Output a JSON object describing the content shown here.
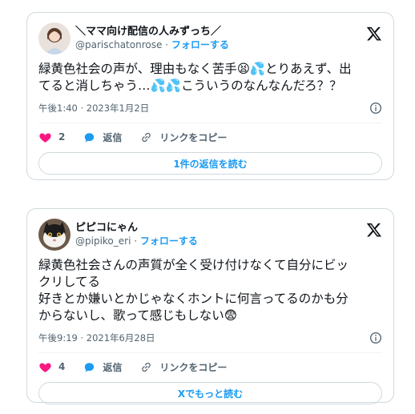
{
  "tweets": [
    {
      "display_name": "＼ママ向け配信の人みずっち／",
      "handle": "@parischatonrose",
      "separator": " · ",
      "follow_label": "フォローする",
      "text_lines": [
        "緑黄色社会の声が、理由もなく苦手😫💦とりあえず、出",
        "てると消しちゃう…💦💦こういうのなんなんだろ？？"
      ],
      "timestamp": "午後1:40 · 2023年1月2日",
      "like_count": "2",
      "reply_label": "返信",
      "copy_link_label": "リンクをコピー",
      "read_button_label": "1件の返信を読む"
    },
    {
      "display_name": "ピピコにゃん",
      "handle": "@pipiko_eri",
      "separator": " · ",
      "follow_label": "フォローする",
      "text_lines": [
        "緑黄色社会さんの声質が全く受け付けなくて自分にビッ",
        "クリしてる",
        "好きとか嫌いとかじゃなくホントに何言ってるのかも分",
        "からないし、歌って感じもしない😨"
      ],
      "timestamp": "午後9:19 · 2021年6月28日",
      "like_count": "4",
      "reply_label": "返信",
      "copy_link_label": "リンクをコピー",
      "read_button_label": "Xでもっと読む"
    }
  ],
  "colors": {
    "accent": "#1d9bf0",
    "like": "#f91880",
    "text": "#0f1419",
    "muted": "#536471",
    "border": "#cfd9de"
  },
  "icons": [
    "x-logo-icon",
    "info-icon",
    "heart-icon",
    "reply-bubble-icon",
    "link-icon"
  ]
}
